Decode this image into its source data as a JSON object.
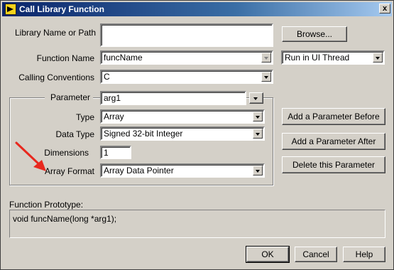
{
  "window": {
    "title": "Call Library Function",
    "close_glyph": "x"
  },
  "labels": {
    "library_name": "Library Name or Path",
    "function_name": "Function Name",
    "calling_conventions": "Calling Conventions",
    "parameter": "Parameter",
    "type": "Type",
    "data_type": "Data Type",
    "dimensions": "Dimensions",
    "array_format": "Array Format",
    "function_prototype": "Function Prototype:"
  },
  "fields": {
    "library_path": "",
    "function_name": "funcName",
    "thread": "Run in UI Thread",
    "calling_convention": "C",
    "parameter": "arg1",
    "type": "Array",
    "data_type": "Signed 32-bit Integer",
    "dimensions": "1",
    "array_format": "Array Data Pointer",
    "prototype": "void funcName(long *arg1);"
  },
  "buttons": {
    "browse": "Browse...",
    "add_before": "Add a Parameter Before",
    "add_after": "Add a Parameter After",
    "delete": "Delete this Parameter",
    "ok": "OK",
    "cancel": "Cancel",
    "help": "Help"
  },
  "annotation": {
    "arrow_color": "#e8281e"
  },
  "colors": {
    "dialog_bg": "#d4d0c8",
    "titlebar_start": "#0a246a",
    "titlebar_end": "#a6caf0"
  }
}
